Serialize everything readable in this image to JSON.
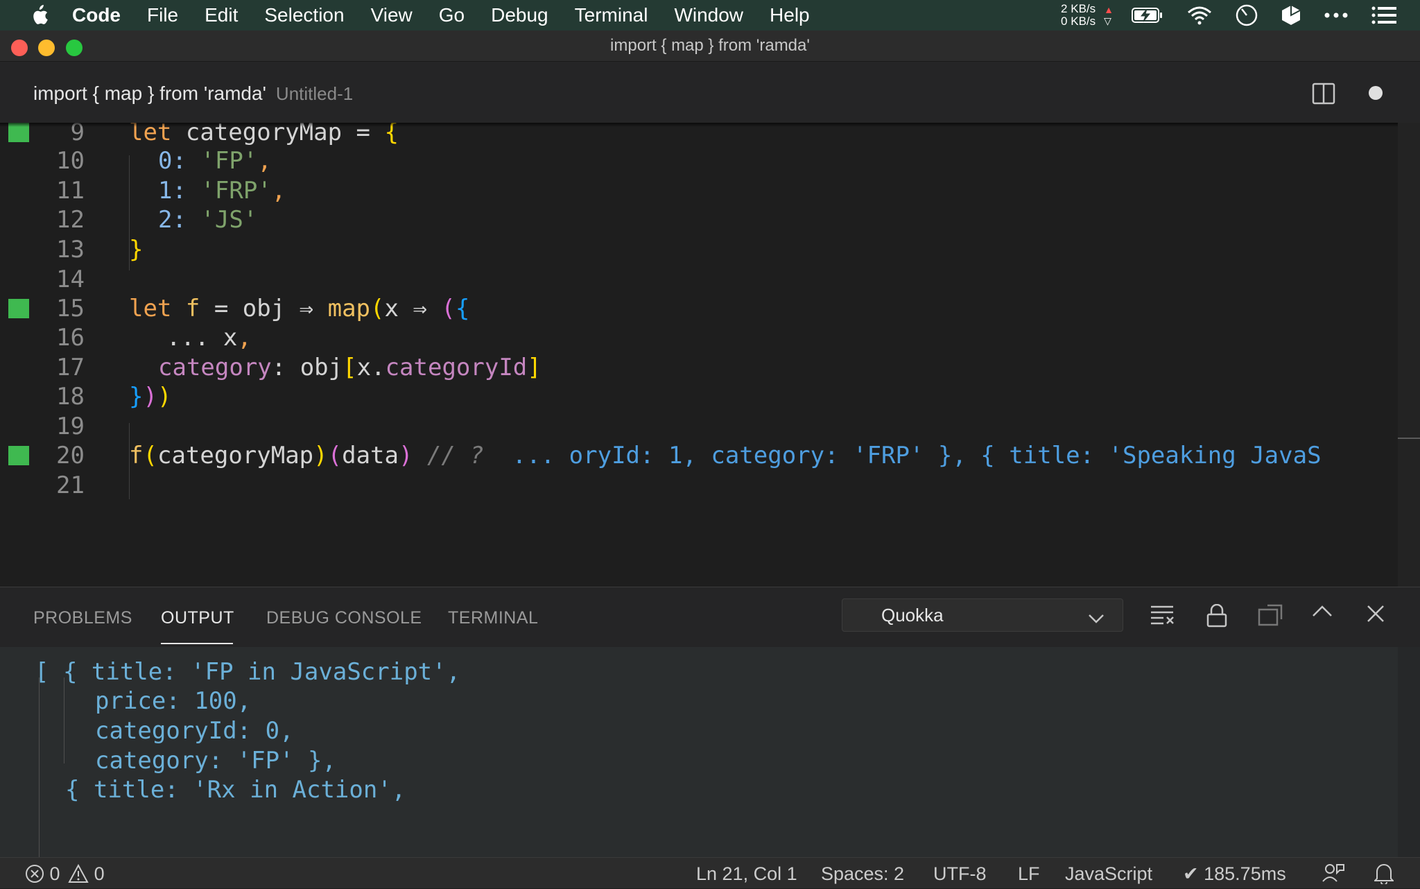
{
  "menubar": {
    "app": "Code",
    "items": [
      "File",
      "Edit",
      "Selection",
      "View",
      "Go",
      "Debug",
      "Terminal",
      "Window",
      "Help"
    ],
    "net_up": "2 KB/s",
    "net_down": "0 KB/s"
  },
  "window": {
    "title": "import { map } from 'ramda'"
  },
  "tab": {
    "title": "import { map } from 'ramda'",
    "description": "Untitled-1"
  },
  "editor": {
    "lines": [
      {
        "no": "9"
      },
      {
        "no": "10"
      },
      {
        "no": "11"
      },
      {
        "no": "12"
      },
      {
        "no": "13"
      },
      {
        "no": "14"
      },
      {
        "no": "15"
      },
      {
        "no": "16"
      },
      {
        "no": "17"
      },
      {
        "no": "18"
      },
      {
        "no": "19"
      },
      {
        "no": "20"
      },
      {
        "no": "21"
      }
    ],
    "tokens": {
      "let": "let",
      "categoryMap_decl": " categoryMap = ",
      "obrace": "{",
      "cbrace": "}",
      "k0": "0: ",
      "v0": "'FP'",
      "k1": "1: ",
      "v1": "'FRP'",
      "k2": "2: ",
      "v2": "'JS'",
      "comma": ",",
      "f_decl": " f",
      "eq": " = obj ⇒ ",
      "map": "map",
      "oparen": "(",
      "x_arrow": "x ⇒ ",
      "oparen2": "(",
      "obrace2": "{",
      "spread": "... x",
      "category": "category",
      "colon_obj": ": obj",
      "obracket": "[",
      "x_dot": "x.",
      "categoryId": "categoryId",
      "cbracket": "]",
      "close_b": "}",
      "close_p": ")",
      "close_p2": ")",
      "f_call": "f",
      "categoryMap_arg": "categoryMap",
      "data_arg": "data",
      "comment": " // ?  ",
      "inline_result": "... oryId: 1, category: 'FRP' }, { title: 'Speaking JavaS"
    }
  },
  "panel": {
    "tabs": [
      "PROBLEMS",
      "OUTPUT",
      "DEBUG CONSOLE",
      "TERMINAL"
    ],
    "active_tab": "OUTPUT",
    "channel": "Quokka",
    "output_lines": [
      "[ { title: 'FP in JavaScript',",
      "price: 100,",
      "categoryId: 0,",
      "category: 'FP' },",
      "{ title: 'Rx in Action',"
    ]
  },
  "status": {
    "errors": "0",
    "warnings": "0",
    "position": "Ln 21, Col 1",
    "spaces": "Spaces: 2",
    "encoding": "UTF-8",
    "eol": "LF",
    "language": "JavaScript",
    "timing": "✔ 185.75ms"
  },
  "colors": {
    "gutter_marker": "#3fb950",
    "menubar_bg": "#243a33",
    "editor_bg": "#1e1e1e",
    "output_text": "#6bb0d8"
  }
}
